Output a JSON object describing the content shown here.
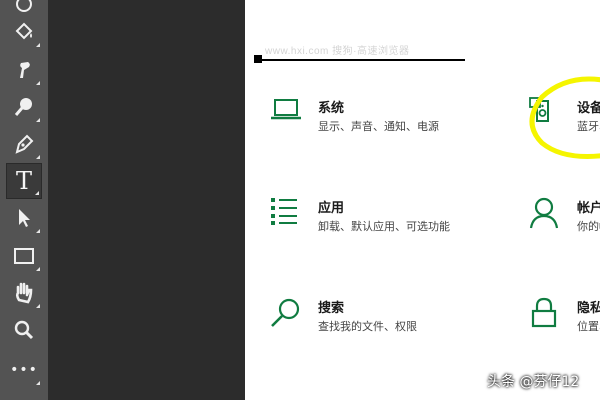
{
  "toolbar": {
    "tools": [
      {
        "name": "dodge-tool-icon"
      },
      {
        "name": "paint-bucket-tool-icon"
      },
      {
        "name": "smudge-tool-icon"
      },
      {
        "name": "dodge-burn-tool-icon"
      },
      {
        "name": "pen-tool-icon"
      },
      {
        "name": "type-tool-icon",
        "label": "T",
        "active": true
      },
      {
        "name": "path-selection-tool-icon"
      },
      {
        "name": "rectangle-tool-icon"
      },
      {
        "name": "hand-tool-icon"
      },
      {
        "name": "zoom-tool-icon"
      },
      {
        "name": "more-tools-icon",
        "label": "•••"
      }
    ]
  },
  "canvas": {
    "faint_text": "www.hxi.com 搜狗·高速浏览器",
    "items": [
      {
        "title": "系统",
        "desc": "显示、声音、通知、电源",
        "icon": "laptop-icon"
      },
      {
        "title": "设备",
        "desc": "蓝牙、打印机、鼠标",
        "icon": "devices-icon"
      },
      {
        "title": "应用",
        "desc": "卸载、默认应用、可选功能",
        "icon": "apps-list-icon"
      },
      {
        "title": "帐户",
        "desc": "你的帐户、电子邮件、同步设置",
        "icon": "account-icon"
      },
      {
        "title": "搜索",
        "desc": "查找我的文件、权限",
        "icon": "search-icon"
      },
      {
        "title": "隐私",
        "desc": "位置、相机、麦克风",
        "icon": "lock-icon"
      }
    ],
    "accent_color": "#107c41",
    "highlight_color": "#f5f500"
  },
  "watermark": "头条 @芬仔12"
}
